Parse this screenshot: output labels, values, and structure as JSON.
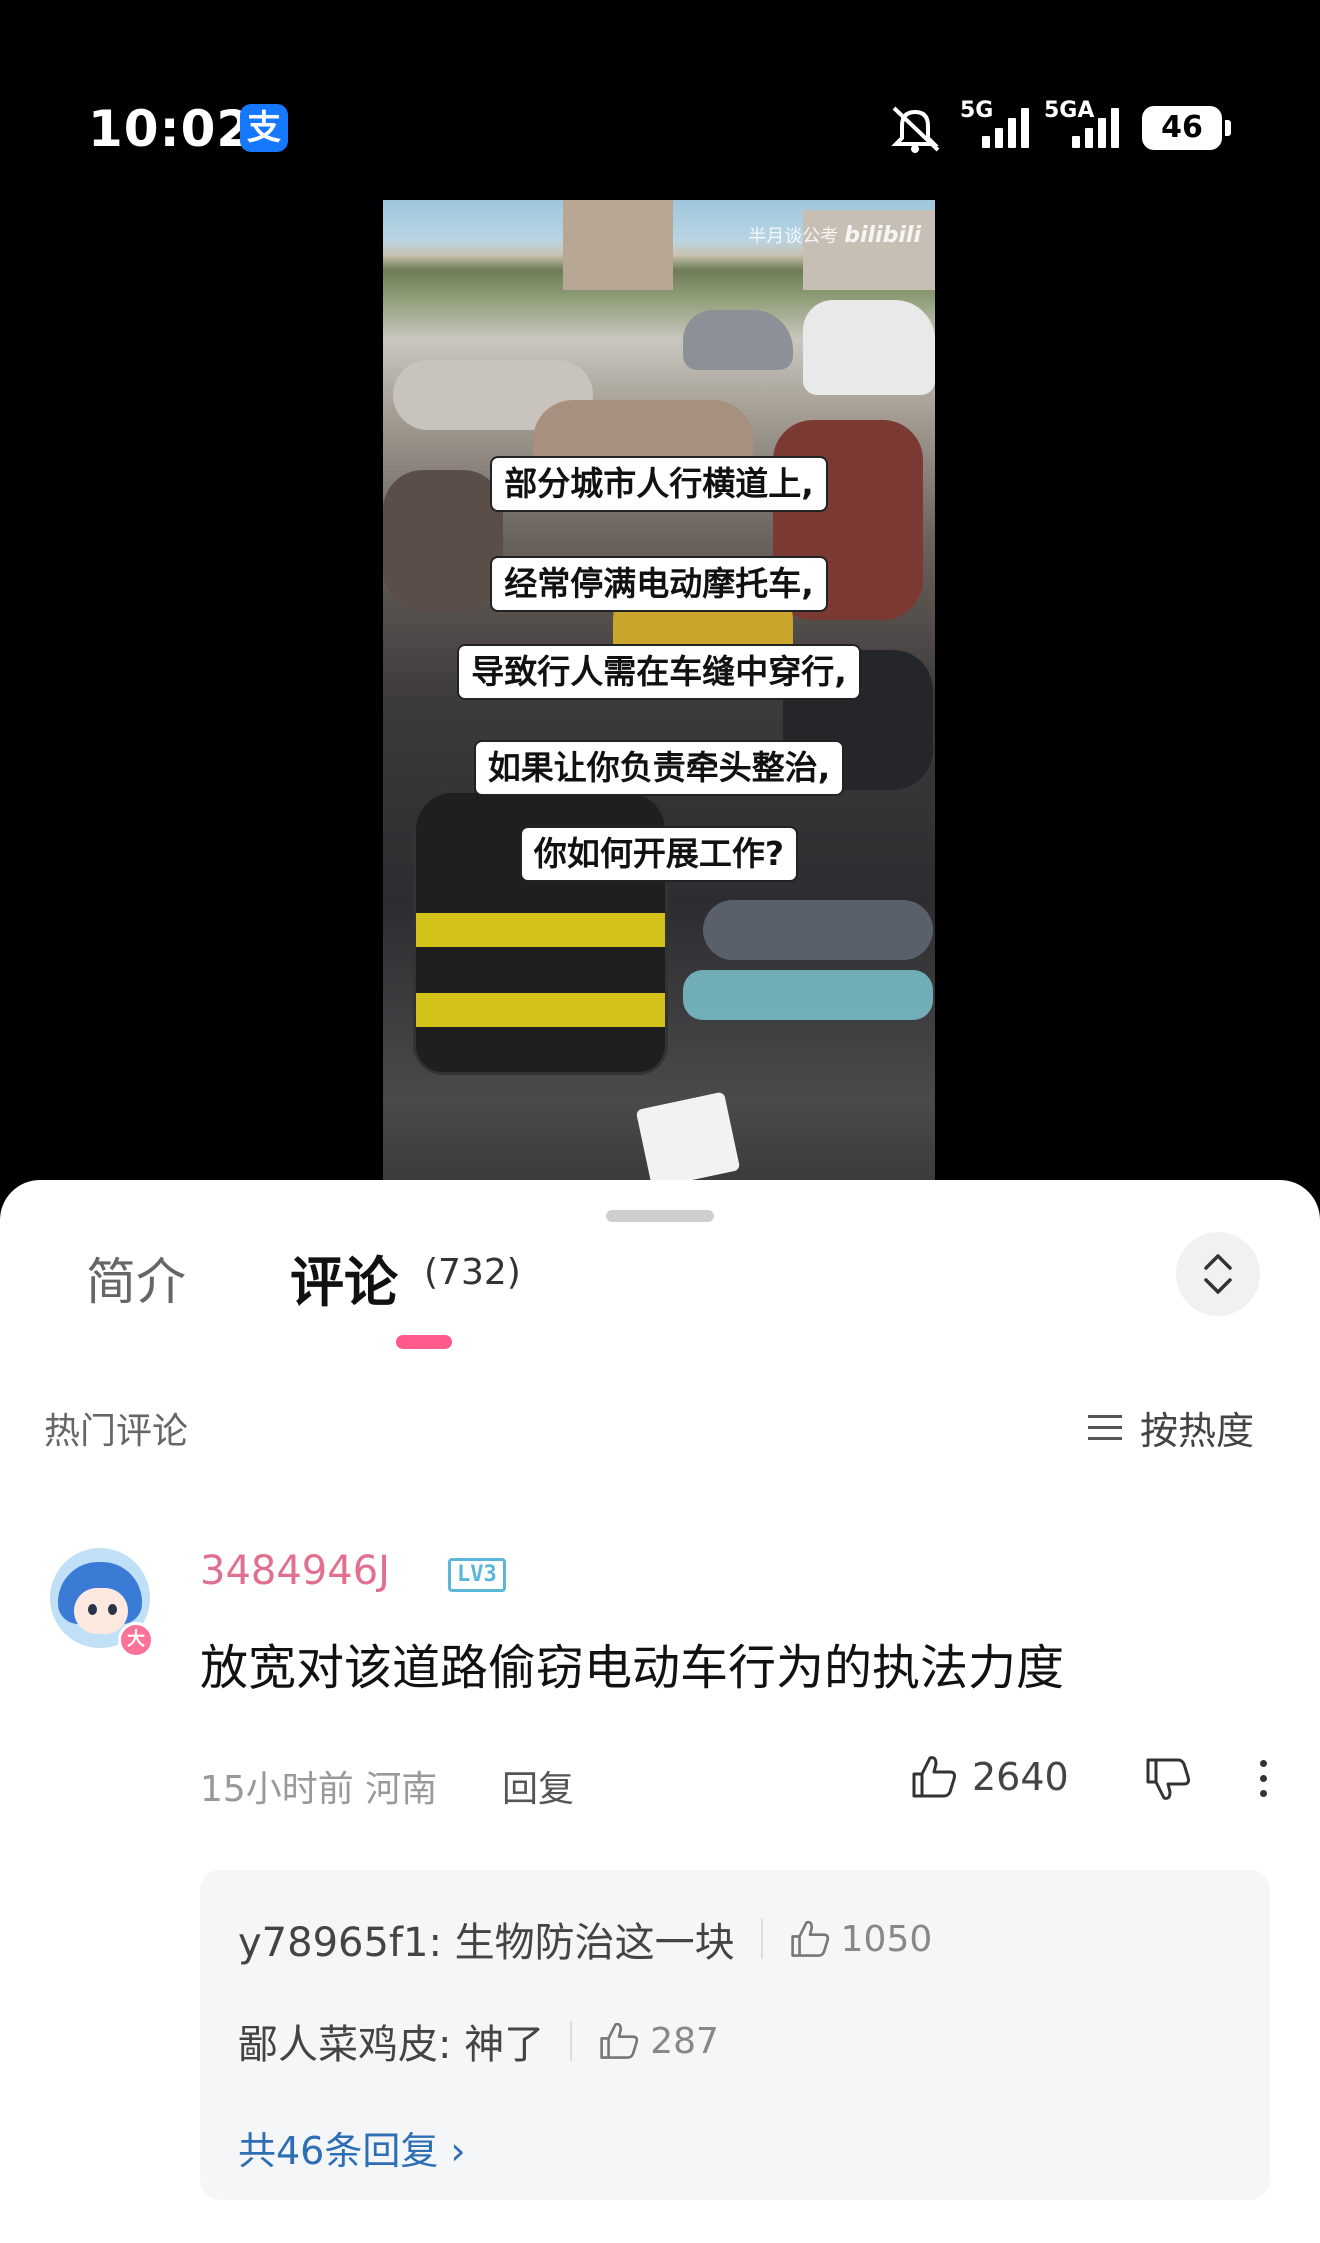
{
  "status_bar": {
    "time": "10:02",
    "app_badge": "支",
    "signal1_label": "5G",
    "signal2_label": "5GA",
    "battery": "46"
  },
  "video": {
    "watermark_text": "半月谈公考",
    "watermark_brand": "bilibili",
    "captions": [
      "部分城市人行横道上,",
      "经常停满电动摩托车,",
      "导致行人需在车缝中穿行,",
      "如果让你负责牵头整治,",
      "你如何开展工作?"
    ]
  },
  "tabs": {
    "intro": "简介",
    "comments": "评论",
    "comments_count": "(732)"
  },
  "comments_header": {
    "hot_label": "热门评论",
    "sort_label": "按热度"
  },
  "comment": {
    "username": "3484946J",
    "level": "LV3",
    "avatar_badge": "大",
    "text": "放宽对该道路偷窃电动车行为的执法力度",
    "meta": "15小时前 河南",
    "reply_label": "回复",
    "likes": "2640"
  },
  "replies": [
    {
      "text": "y78965f1: 生物防治这一块",
      "likes": "1050"
    },
    {
      "text": "鄙人菜鸡皮: 神了",
      "likes": "287"
    }
  ],
  "more_replies": "共46条回复 ›",
  "colors": {
    "accent_pink": "#fb7299",
    "username_pink": "#e0708e",
    "link_blue": "#2e6eb5"
  }
}
